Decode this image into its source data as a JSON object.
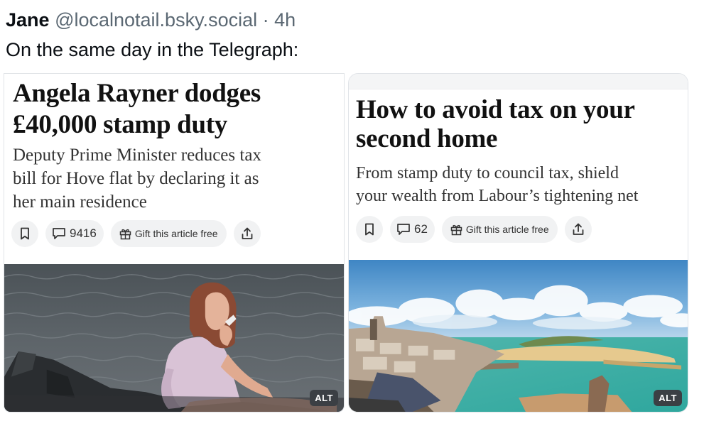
{
  "post": {
    "author_name": "Jane",
    "author_handle": "@localnotail.bsky.social",
    "separator": "·",
    "time": "4h",
    "text": "On the same day in the Telegraph:"
  },
  "articles": [
    {
      "headline_line1": "Angela Rayner dodges",
      "headline_line2": "£40,000 stamp duty",
      "subhead_line1": "Deputy Prime Minister reduces tax",
      "subhead_line2": "bill for Hove flat by declaring it as",
      "subhead_line3": "her main residence",
      "comments": "9416",
      "gift_label": "Gift this article free",
      "alt": "ALT",
      "icons": [
        "bookmark-icon",
        "comment-icon",
        "gift-icon",
        "share-icon"
      ]
    },
    {
      "headline_line1": "How to avoid tax on your",
      "headline_line2": "second home",
      "subhead_line1": "From stamp duty to council tax, shield",
      "subhead_line2": "your wealth from Labour’s tightening net",
      "comments": "62",
      "gift_label": "Gift this article free",
      "alt": "ALT",
      "icons": [
        "bookmark-icon",
        "comment-icon",
        "gift-icon",
        "share-icon"
      ]
    }
  ],
  "colors": {
    "text": "#0f1419",
    "muted": "#5b6873",
    "pill_bg": "#f1f2f3",
    "alt_badge": "#3b3f44"
  }
}
